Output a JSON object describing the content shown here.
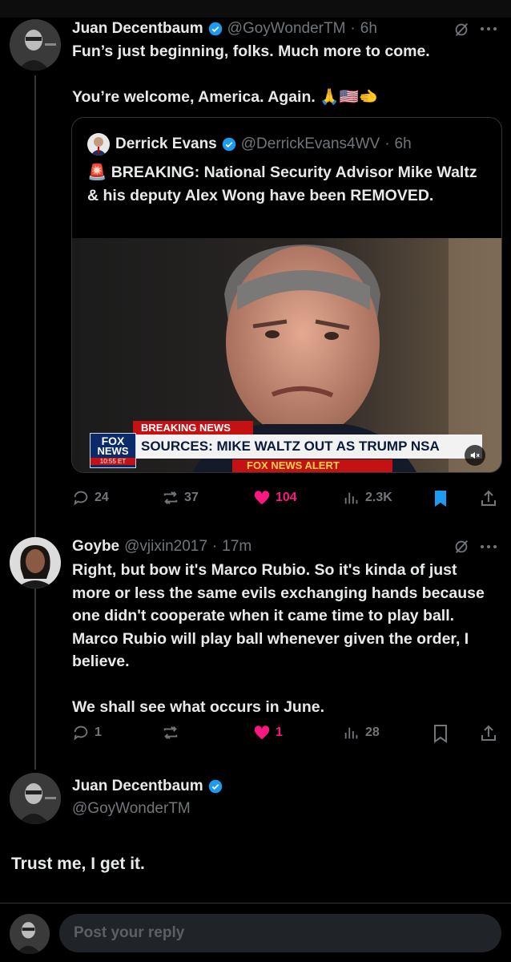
{
  "tweet1": {
    "name": "Juan Decentbaum",
    "handle": "@GoyWonderTM",
    "time": "6h",
    "text": "Fun’s just beginning, folks. Much more to come.\n\nYou’re welcome, America. Again. 🙏🇺🇸🫲"
  },
  "quote": {
    "name": "Derrick Evans",
    "handle": "@DerrickEvans4WV",
    "time": "6h",
    "text": "🚨 BREAKING: National Security Advisor Mike Waltz & his deputy Alex Wong have been REMOVED.",
    "image": {
      "badge_top": "BREAKING NEWS",
      "headline": "SOURCES: MIKE WALTZ OUT AS TRUMP NSA",
      "logo_top": "FOX",
      "logo_bottom": "NEWS",
      "time": "10:55 ET",
      "alert": "FOX NEWS ALERT"
    }
  },
  "tweet1_actions": {
    "replies": "24",
    "reposts": "37",
    "likes": "104",
    "views": "2.3K"
  },
  "tweet2": {
    "name": "Goybe",
    "handle": "@vjixin2017",
    "time": "17m",
    "text": "Right, but bow it's Marco Rubio. So it's kinda of just more or less the same evils exchanging hands because one didn't cooperate when it came time to play ball. Marco Rubio will play ball whenever given the order, I believe.\n\nWe shall see what occurs in June."
  },
  "tweet2_actions": {
    "replies": "1",
    "reposts": "",
    "likes": "1",
    "views": "28"
  },
  "main": {
    "name": "Juan Decentbaum",
    "handle": "@GoyWonderTM",
    "text": "Trust me, I get it."
  },
  "reply": {
    "placeholder": "Post your reply"
  },
  "colors": {
    "bg": "#000000",
    "text": "#e7e9ea",
    "muted": "#71767b",
    "like": "#f91880",
    "accent": "#1d9bf0"
  }
}
